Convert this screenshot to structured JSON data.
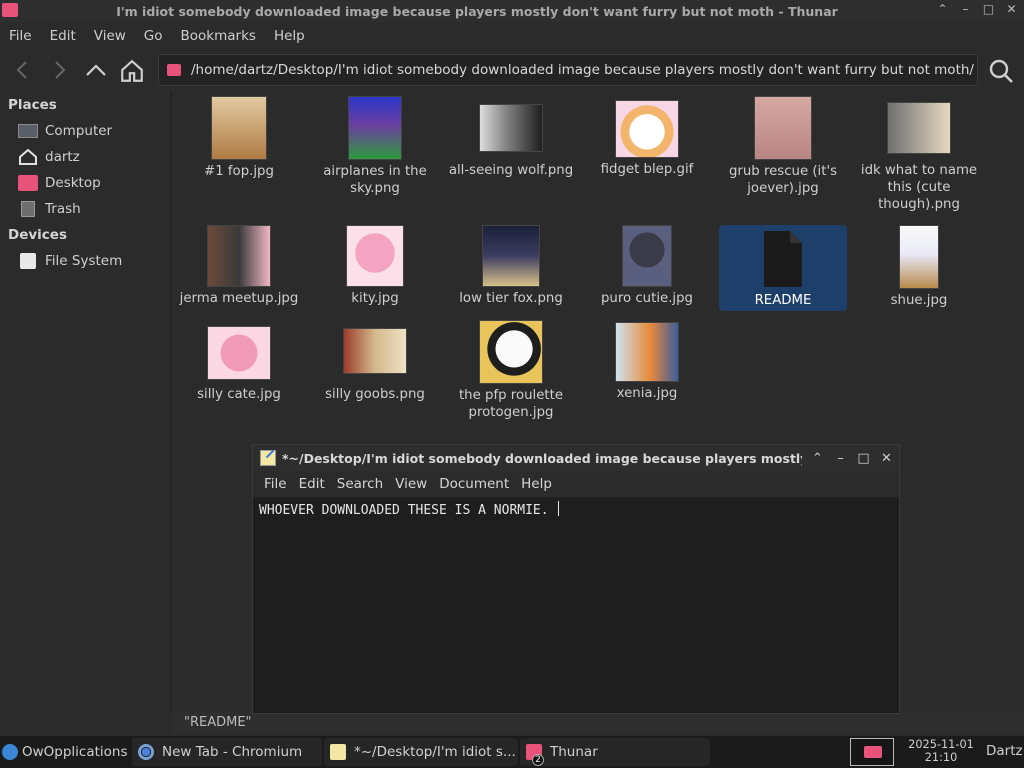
{
  "thunar": {
    "title": "I'm idiot somebody downloaded image because players mostly don't want furry but not moth - Thunar",
    "menu": [
      "File",
      "Edit",
      "View",
      "Go",
      "Bookmarks",
      "Help"
    ],
    "path": "/home/dartz/Desktop/I'm idiot somebody downloaded image because players mostly don't want furry but not moth/",
    "sidebar": {
      "places_header": "Places",
      "places": [
        {
          "label": "Computer",
          "icon": "computer-icon"
        },
        {
          "label": "dartz",
          "icon": "home-icon"
        },
        {
          "label": "Desktop",
          "icon": "desktop-folder-icon"
        },
        {
          "label": "Trash",
          "icon": "trash-icon"
        }
      ],
      "devices_header": "Devices",
      "devices": [
        {
          "label": "File System",
          "icon": "drive-icon"
        }
      ]
    },
    "files": [
      {
        "name": "#1 fop.jpg"
      },
      {
        "name": "airplanes in the sky.png"
      },
      {
        "name": "all-seeing wolf.png"
      },
      {
        "name": "fidget blep.gif"
      },
      {
        "name": "grub rescue (it's joever).jpg"
      },
      {
        "name": "idk what to name this (cute though).png"
      },
      {
        "name": "jerma meetup.jpg"
      },
      {
        "name": "kity.jpg"
      },
      {
        "name": "low tier fox.png"
      },
      {
        "name": "puro cutie.jpg"
      },
      {
        "name": "README",
        "selected": true
      },
      {
        "name": "shue.jpg"
      },
      {
        "name": "silly cate.jpg"
      },
      {
        "name": "silly goobs.png"
      },
      {
        "name": "the pfp roulette protogen.jpg"
      },
      {
        "name": "xenia.jpg"
      }
    ],
    "status": "\"README\""
  },
  "mousepad": {
    "title": "*~/Desktop/I'm idiot somebody downloaded image because players mostly d",
    "menu": [
      "File",
      "Edit",
      "Search",
      "View",
      "Document",
      "Help"
    ],
    "content": "WHOEVER DOWNLOADED THESE IS A NORMIE. "
  },
  "panel": {
    "tasks": [
      {
        "label": "OwOpplications",
        "icon": "app-menu-icon"
      },
      {
        "label": "New Tab - Chromium",
        "icon": "chromium-icon"
      },
      {
        "label": "*~/Desktop/I'm idiot s...",
        "icon": "text-editor-icon"
      },
      {
        "label": "Thunar",
        "icon": "folder-icon",
        "badge": "2"
      }
    ],
    "date": "2025-11-01",
    "time": "21:10",
    "user": "Dartz"
  },
  "colors": {
    "accent_folder": "#e9537b",
    "selection": "#1f3f6b",
    "background": "#2b2b2b"
  }
}
